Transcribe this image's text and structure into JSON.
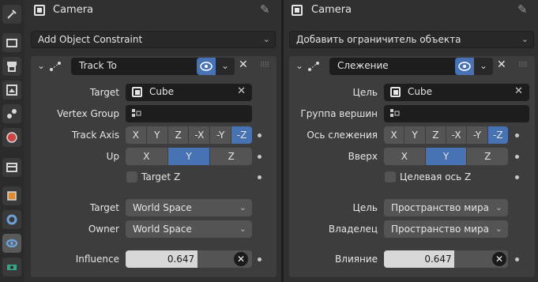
{
  "tabs": [
    {
      "icon": "tool-icon"
    },
    {
      "icon": "render-icon"
    },
    {
      "icon": "output-icon"
    },
    {
      "icon": "view-layer-icon"
    },
    {
      "icon": "scene-icon"
    },
    {
      "icon": "world-icon"
    },
    {
      "icon": "collection-icon"
    },
    {
      "icon": "object-icon"
    },
    {
      "icon": "modifier-icon"
    },
    {
      "icon": "constraint-icon"
    },
    {
      "icon": "data-icon"
    }
  ],
  "left": {
    "header_title": "Camera",
    "add_constraint": "Add Object Constraint",
    "constraint_name": "Track To",
    "target_label": "Target",
    "target_value": "Cube",
    "vertex_group_label": "Vertex Group",
    "track_axis_label": "Track Axis",
    "track_axis_options": [
      "X",
      "Y",
      "Z",
      "-X",
      "-Y",
      "-Z"
    ],
    "track_axis_selected": "-Z",
    "up_label": "Up",
    "up_options": [
      "X",
      "Y",
      "Z"
    ],
    "up_selected": "Y",
    "target_z_label": "Target Z",
    "target_space_label": "Target",
    "target_space_value": "World Space",
    "owner_space_label": "Owner",
    "owner_space_value": "World Space",
    "influence_label": "Influence",
    "influence_value": "0.647"
  },
  "right": {
    "header_title": "Camera",
    "add_constraint": "Добавить ограничитель объекта",
    "constraint_name": "Слежение",
    "target_label": "Цель",
    "target_value": "Cube",
    "vertex_group_label": "Группа вершин",
    "track_axis_label": "Ось слежения",
    "track_axis_options": [
      "X",
      "Y",
      "Z",
      "-X",
      "-Y",
      "-Z"
    ],
    "track_axis_selected": "-Z",
    "up_label": "Вверх",
    "up_options": [
      "X",
      "Y",
      "Z"
    ],
    "up_selected": "Y",
    "target_z_label": "Целевая ось Z",
    "target_space_label": "Цель",
    "target_space_value": "Пространство мира",
    "owner_space_label": "Владелец",
    "owner_space_value": "Пространство мира",
    "influence_label": "Влияние",
    "influence_value": "0.647"
  },
  "influence_fraction": 0.647,
  "colors": {
    "accent": "#4772b3",
    "panel": "#303030",
    "box": "#3d3d3d",
    "field": "#1d1d1d"
  }
}
